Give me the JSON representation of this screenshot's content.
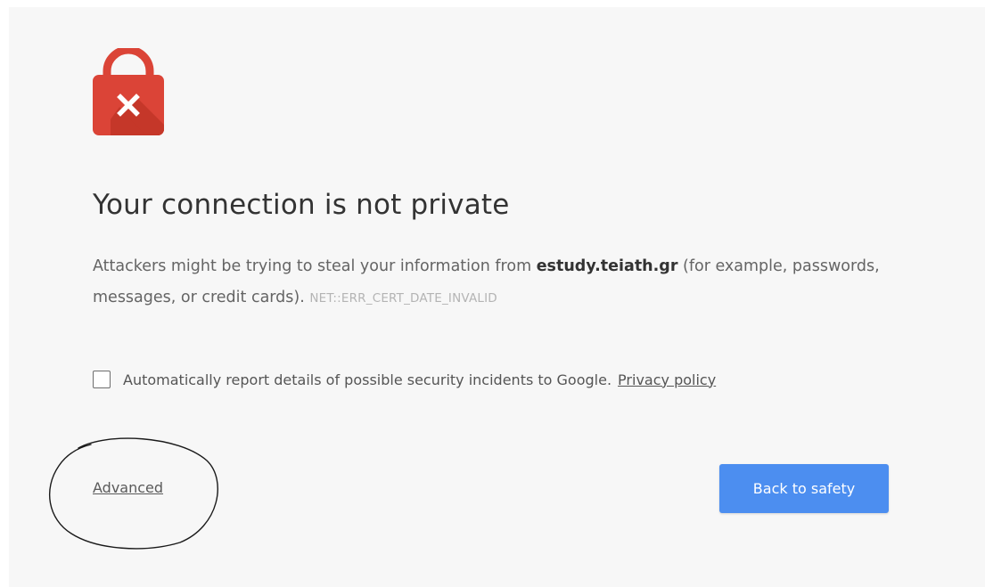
{
  "interstitial": {
    "icon": "lock-error-icon",
    "headline": "Your connection is not private",
    "explanation": {
      "before_host": "Attackers might be trying to steal your information from ",
      "host": "estudy.teiath.gr",
      "after_host": " (for example, passwords, messages, or credit cards). ",
      "error_code": "NET::ERR_CERT_DATE_INVALID"
    },
    "report_checkbox": {
      "checked": false,
      "label": "Automatically report details of possible security incidents to Google.",
      "privacy_link": "Privacy policy"
    },
    "advanced_link": "Advanced",
    "back_button": "Back to safety"
  },
  "colors": {
    "lock_red": "#db4437",
    "button_blue": "#4c8ef0",
    "background": "#f7f7f7"
  }
}
